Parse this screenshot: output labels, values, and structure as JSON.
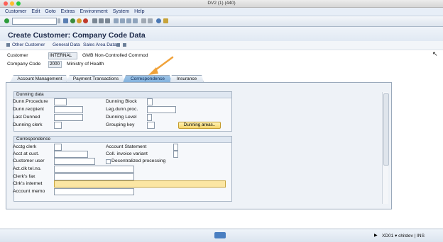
{
  "window": {
    "title": "DV2 (1) (440)"
  },
  "menu": [
    "Customer",
    "Edit",
    "Goto",
    "Extras",
    "Environment",
    "System",
    "Help"
  ],
  "page_title": "Create Customer: Company Code Data",
  "app_toolbar": {
    "other_customer": "Other Customer",
    "general_data": "General Data",
    "sales_area_data": "Sales Area Data"
  },
  "header": {
    "customer_label": "Customer",
    "customer_value": "INTERNAL",
    "customer_desc": "GMB Non-Controlled Commod",
    "company_code_label": "Company Code",
    "company_code_value": "2000",
    "company_code_desc": "Ministry of  Health"
  },
  "tabs": [
    "Account Management",
    "Payment Transactions",
    "Correspondence",
    "Insurance"
  ],
  "dunning": {
    "title": "Dunning data",
    "dunn_procedure": "Dunn.Procedure",
    "dunn_recipient": "Dunn.recipient",
    "last_dunned": "Last Dunned",
    "dunning_clerk": "Dunning clerk",
    "dunning_block": "Dunning Block",
    "leg_dunn_proc": "Leg.dunn.proc.",
    "dunning_level": "Dunning Level",
    "grouping_key": "Grouping key",
    "dunning_areas_button": "Dunning areas.."
  },
  "correspondence": {
    "title": "Correspondence",
    "acctg_clerk": "Acctg clerk",
    "acct_at_cust": "Acct at cust.",
    "customer_user": "Customer user",
    "act_clk_tel": "Act.clk tel.no.",
    "clerks_fax": "Clerk's fax",
    "clrks_internet": "Clrk's internet",
    "account_memo": "Account memo",
    "account_statement": "Account Statement",
    "coll_invoice_variant": "Coll. invoice variant",
    "decentralized": "Decentralized processing"
  },
  "status": {
    "text": "XD01",
    "user": "chitdev",
    "mode": "INS"
  },
  "colors": {
    "highlight_field": "#fbe6a3",
    "arrow": "#f0a23a"
  }
}
